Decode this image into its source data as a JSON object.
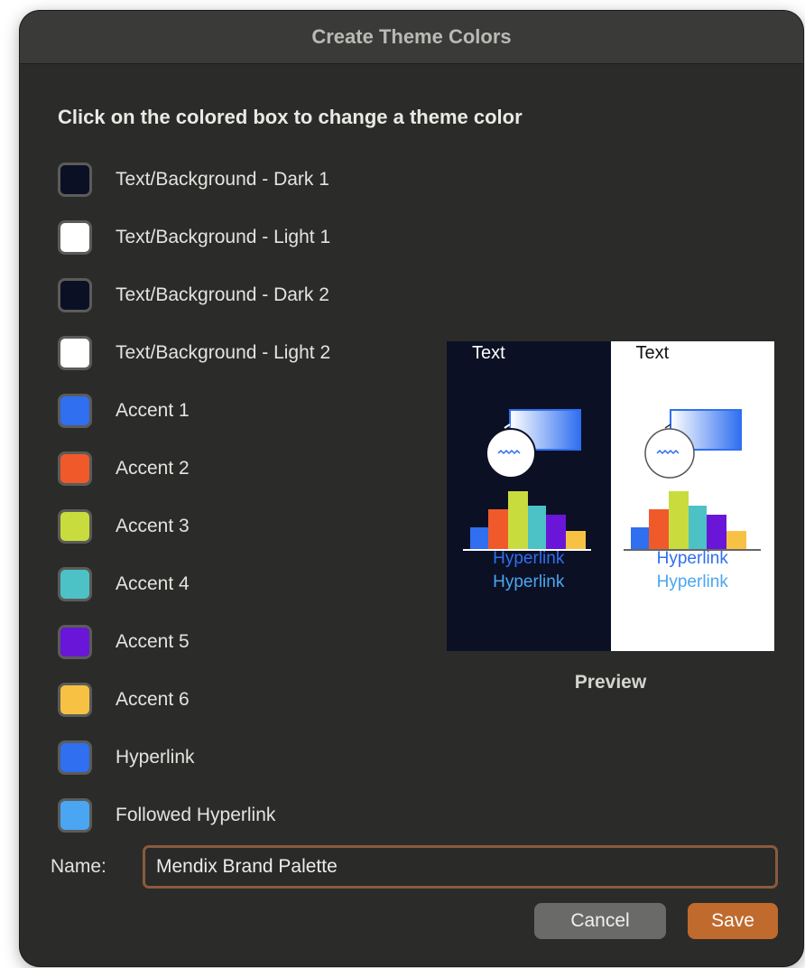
{
  "dialog": {
    "title": "Create Theme Colors",
    "instruction": "Click on the colored box to change a theme color"
  },
  "colors": [
    {
      "label": "Text/Background - Dark 1",
      "color": "#0c1024"
    },
    {
      "label": "Text/Background - Light 1",
      "color": "#ffffff"
    },
    {
      "label": "Text/Background - Dark 2",
      "color": "#0c1024"
    },
    {
      "label": "Text/Background - Light 2",
      "color": "#ffffff"
    },
    {
      "label": "Accent 1",
      "color": "#2f6ff0"
    },
    {
      "label": "Accent 2",
      "color": "#f05a2a"
    },
    {
      "label": "Accent 3",
      "color": "#c9dc3e"
    },
    {
      "label": "Accent 4",
      "color": "#4cc2c6"
    },
    {
      "label": "Accent 5",
      "color": "#6a16d8"
    },
    {
      "label": "Accent 6",
      "color": "#f7c244"
    },
    {
      "label": "Hyperlink",
      "color": "#2f6ff0"
    },
    {
      "label": "Followed Hyperlink",
      "color": "#4aa6f2"
    }
  ],
  "preview": {
    "dark_text": "Text",
    "light_text": "Text",
    "hyperlink": "Hyperlink",
    "followed_hyperlink": "Hyperlink",
    "label": "Preview"
  },
  "name": {
    "label": "Name:",
    "value": "Mendix Brand Palette"
  },
  "buttons": {
    "cancel": "Cancel",
    "save": "Save"
  }
}
